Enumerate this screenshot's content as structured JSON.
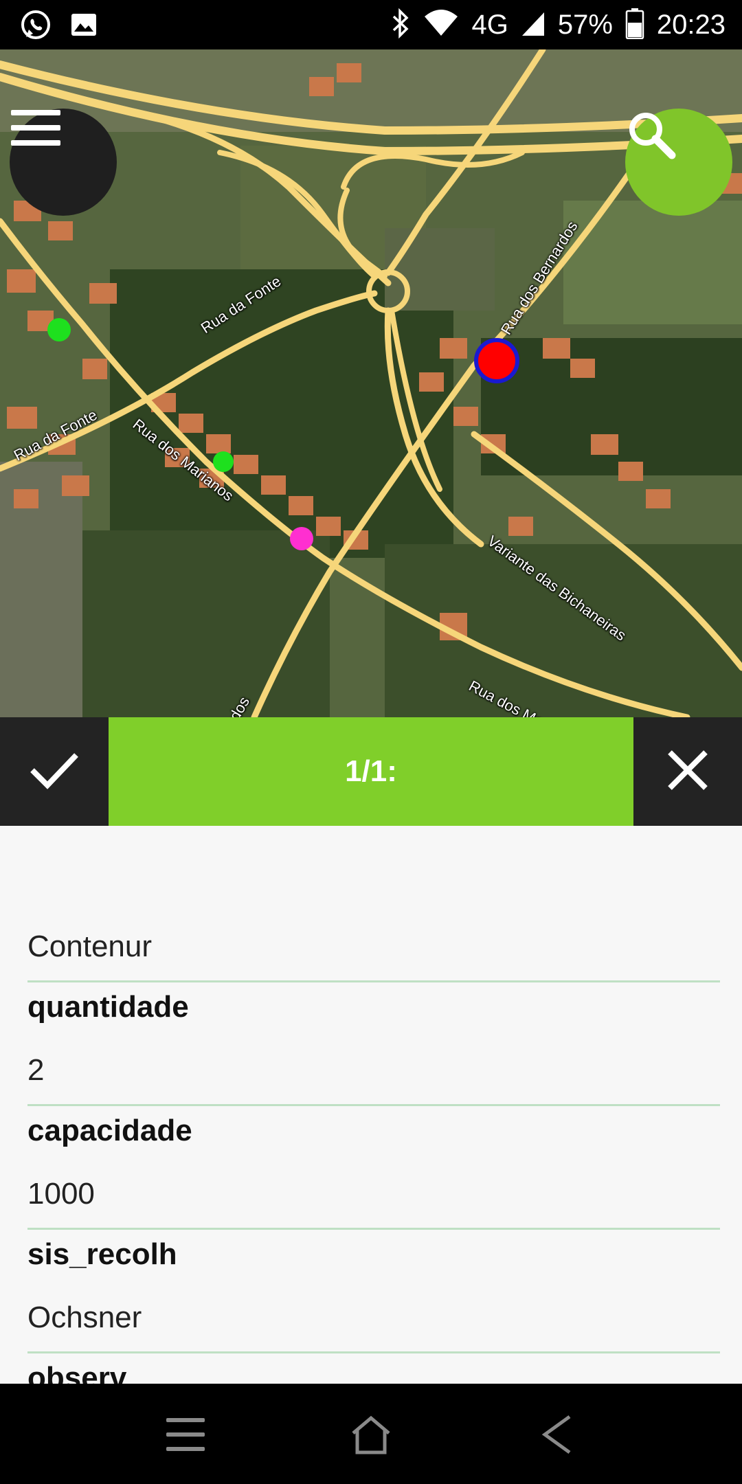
{
  "status_bar": {
    "icons_left": [
      "whatsapp-icon",
      "image-icon"
    ],
    "icons_right": [
      "bluetooth-icon",
      "wifi-icon"
    ],
    "network": "4G",
    "battery": "57%",
    "time": "20:23"
  },
  "map": {
    "road_labels": [
      "Rua da Fonte",
      "Rua da Fonte",
      "Rua dos Marianos",
      "Rua dos Bernardos",
      "Variante das Bichaneiras",
      "Rua dos Mari",
      "dos"
    ],
    "markers": [
      {
        "type": "point",
        "color": "#1ee01e"
      },
      {
        "type": "point",
        "color": "#1ee01e"
      },
      {
        "type": "point",
        "color": "#ff2fd0"
      },
      {
        "type": "selected",
        "color": "#ff0000",
        "stroke": "#1a1ad0"
      }
    ],
    "menu_icon": "hamburger-menu-icon",
    "search_icon": "search-icon"
  },
  "action_bar": {
    "title": "1/1:",
    "confirm_icon": "check-icon",
    "close_icon": "close-icon",
    "accent": "#80cf2a"
  },
  "form": {
    "first_value": "Contenur",
    "fields": [
      {
        "label": "quantidade",
        "value": "2"
      },
      {
        "label": "capacidade",
        "value": "1000"
      },
      {
        "label": "sis_recolh",
        "value": "Ochsner"
      },
      {
        "label": "observ",
        "value": ""
      }
    ]
  },
  "nav_bar": {
    "icons": [
      "recent-apps-icon",
      "home-icon",
      "back-icon"
    ]
  }
}
